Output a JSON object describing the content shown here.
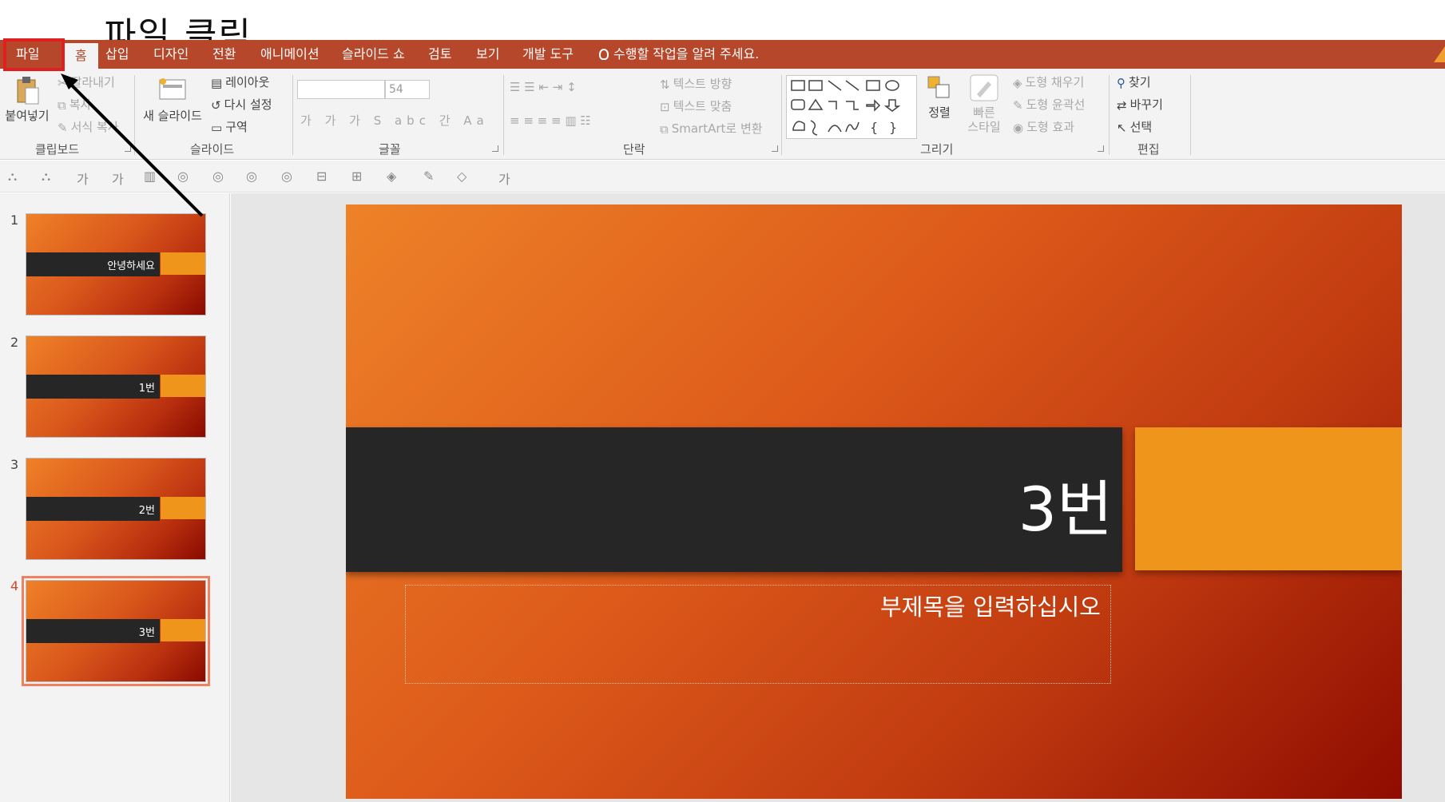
{
  "annotation": {
    "label": "파일 클릭"
  },
  "ribbon_tabs": [
    "파일",
    "홈",
    "삽입",
    "디자인",
    "전환",
    "애니메이션",
    "슬라이드 쇼",
    "검토",
    "보기",
    "개발 도구"
  ],
  "tell_me": "수행할 작업을 알려 주세요.",
  "clipboard": {
    "paste": "붙여넣기",
    "cut": "잘라내기",
    "copy": "복사",
    "format_painter": "서식 복사",
    "group": "클립보드"
  },
  "slides_group": {
    "new_slide": "새 슬라이드",
    "layout": "레이아웃",
    "reset": "다시 설정",
    "section": "구역",
    "group": "슬라이드"
  },
  "font_group": {
    "size": "54",
    "group": "글꼴"
  },
  "paragraph_group": {
    "text_direction": "텍스트 방향",
    "align_text": "텍스트 맞춤",
    "smartart": "SmartArt로 변환",
    "group": "단락"
  },
  "drawing_group": {
    "arrange": "정렬",
    "quick_styles_1": "빠른",
    "quick_styles_2": "스타일",
    "shape_fill": "도형 채우기",
    "shape_outline": "도형 윤곽선",
    "shape_effects": "도형 효과",
    "group": "그리기"
  },
  "editing_group": {
    "find": "찾기",
    "replace": "바꾸기",
    "select": "선택",
    "group": "편집"
  },
  "thumbnails": [
    {
      "num": "1",
      "title": "안녕하세요"
    },
    {
      "num": "2",
      "title": "1번"
    },
    {
      "num": "3",
      "title": "2번"
    },
    {
      "num": "4",
      "title": "3번"
    }
  ],
  "slide": {
    "title": "3번",
    "subtitle_placeholder": "부제목을 입력하십시오"
  },
  "colors": {
    "ribbon_tab_bg": "#b7472a",
    "accent_orange": "#f0951c",
    "dark_bar": "#262626",
    "annotation_red": "#e02020"
  }
}
